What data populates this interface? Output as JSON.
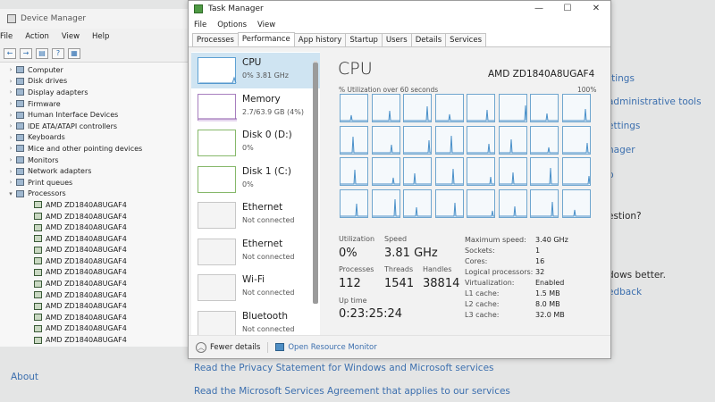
{
  "settings": {
    "right_items": [
      "ttings",
      "administrative tools",
      "ettings",
      "nager",
      "p",
      "estion?",
      "dows better.",
      "edback"
    ],
    "privacy_link": "Read the Privacy Statement for Windows and Microsoft services",
    "msa_link": "Read the Microsoft Services Agreement that applies to our services",
    "about": "About"
  },
  "device_manager": {
    "title": "Device Manager",
    "menu": [
      "File",
      "Action",
      "View",
      "Help"
    ],
    "tree": [
      {
        "label": "Computer"
      },
      {
        "label": "Disk drives"
      },
      {
        "label": "Display adapters"
      },
      {
        "label": "Firmware"
      },
      {
        "label": "Human Interface Devices"
      },
      {
        "label": "IDE ATA/ATAPI controllers"
      },
      {
        "label": "Keyboards"
      },
      {
        "label": "Mice and other pointing devices"
      },
      {
        "label": "Monitors"
      },
      {
        "label": "Network adapters"
      },
      {
        "label": "Print queues"
      },
      {
        "label": "Processors"
      }
    ],
    "processors": [
      "AMD ZD1840A8UGAF4",
      "AMD ZD1840A8UGAF4",
      "AMD ZD1840A8UGAF4",
      "AMD ZD1840A8UGAF4",
      "AMD ZD1840A8UGAF4",
      "AMD ZD1840A8UGAF4",
      "AMD ZD1840A8UGAF4",
      "AMD ZD1840A8UGAF4",
      "AMD ZD1840A8UGAF4",
      "AMD ZD1840A8UGAF4",
      "AMD ZD1840A8UGAF4",
      "AMD ZD1840A8UGAF4",
      "AMD ZD1840A8UGAF4",
      "AMD ZD1840A8UGAF4"
    ]
  },
  "task_manager": {
    "title": "Task Manager",
    "menu": [
      "File",
      "Options",
      "View"
    ],
    "tabs": [
      "Processes",
      "Performance",
      "App history",
      "Startup",
      "Users",
      "Details",
      "Services"
    ],
    "active_tab": "Performance",
    "resources": [
      {
        "name": "CPU",
        "sub": "0% 3.81 GHz",
        "kind": "cpu"
      },
      {
        "name": "Memory",
        "sub": "2.7/63.9 GB (4%)",
        "kind": "mem"
      },
      {
        "name": "Disk 0 (D:)",
        "sub": "0%",
        "kind": "disk"
      },
      {
        "name": "Disk 1 (C:)",
        "sub": "0%",
        "kind": "disk"
      },
      {
        "name": "Ethernet",
        "sub": "Not connected",
        "kind": "net"
      },
      {
        "name": "Ethernet",
        "sub": "Not connected",
        "kind": "net"
      },
      {
        "name": "Wi-Fi",
        "sub": "Not connected",
        "kind": "net"
      },
      {
        "name": "Bluetooth",
        "sub": "Not connected",
        "kind": "net"
      }
    ],
    "cpu": {
      "title": "CPU",
      "model": "AMD ZD1840A8UGAF4",
      "util_caption": "% Utilization over 60 seconds",
      "util_max": "100%",
      "logical_graphs": 32,
      "utilization_label": "Utilization",
      "utilization": "0%",
      "speed_label": "Speed",
      "speed": "3.81 GHz",
      "processes_label": "Processes",
      "processes": "112",
      "threads_label": "Threads",
      "threads": "1541",
      "handles_label": "Handles",
      "handles": "38814",
      "uptime_label": "Up time",
      "uptime": "0:23:25:24",
      "details": [
        {
          "k": "Maximum speed:",
          "v": "3.40 GHz"
        },
        {
          "k": "Sockets:",
          "v": "1"
        },
        {
          "k": "Cores:",
          "v": "16"
        },
        {
          "k": "Logical processors:",
          "v": "32"
        },
        {
          "k": "Virtualization:",
          "v": "Enabled"
        },
        {
          "k": "L1 cache:",
          "v": "1.5 MB"
        },
        {
          "k": "L2 cache:",
          "v": "8.0 MB"
        },
        {
          "k": "L3 cache:",
          "v": "32.0 MB"
        }
      ]
    },
    "footer": {
      "fewer_details": "Fewer details",
      "open_monitor": "Open Resource Monitor"
    }
  }
}
